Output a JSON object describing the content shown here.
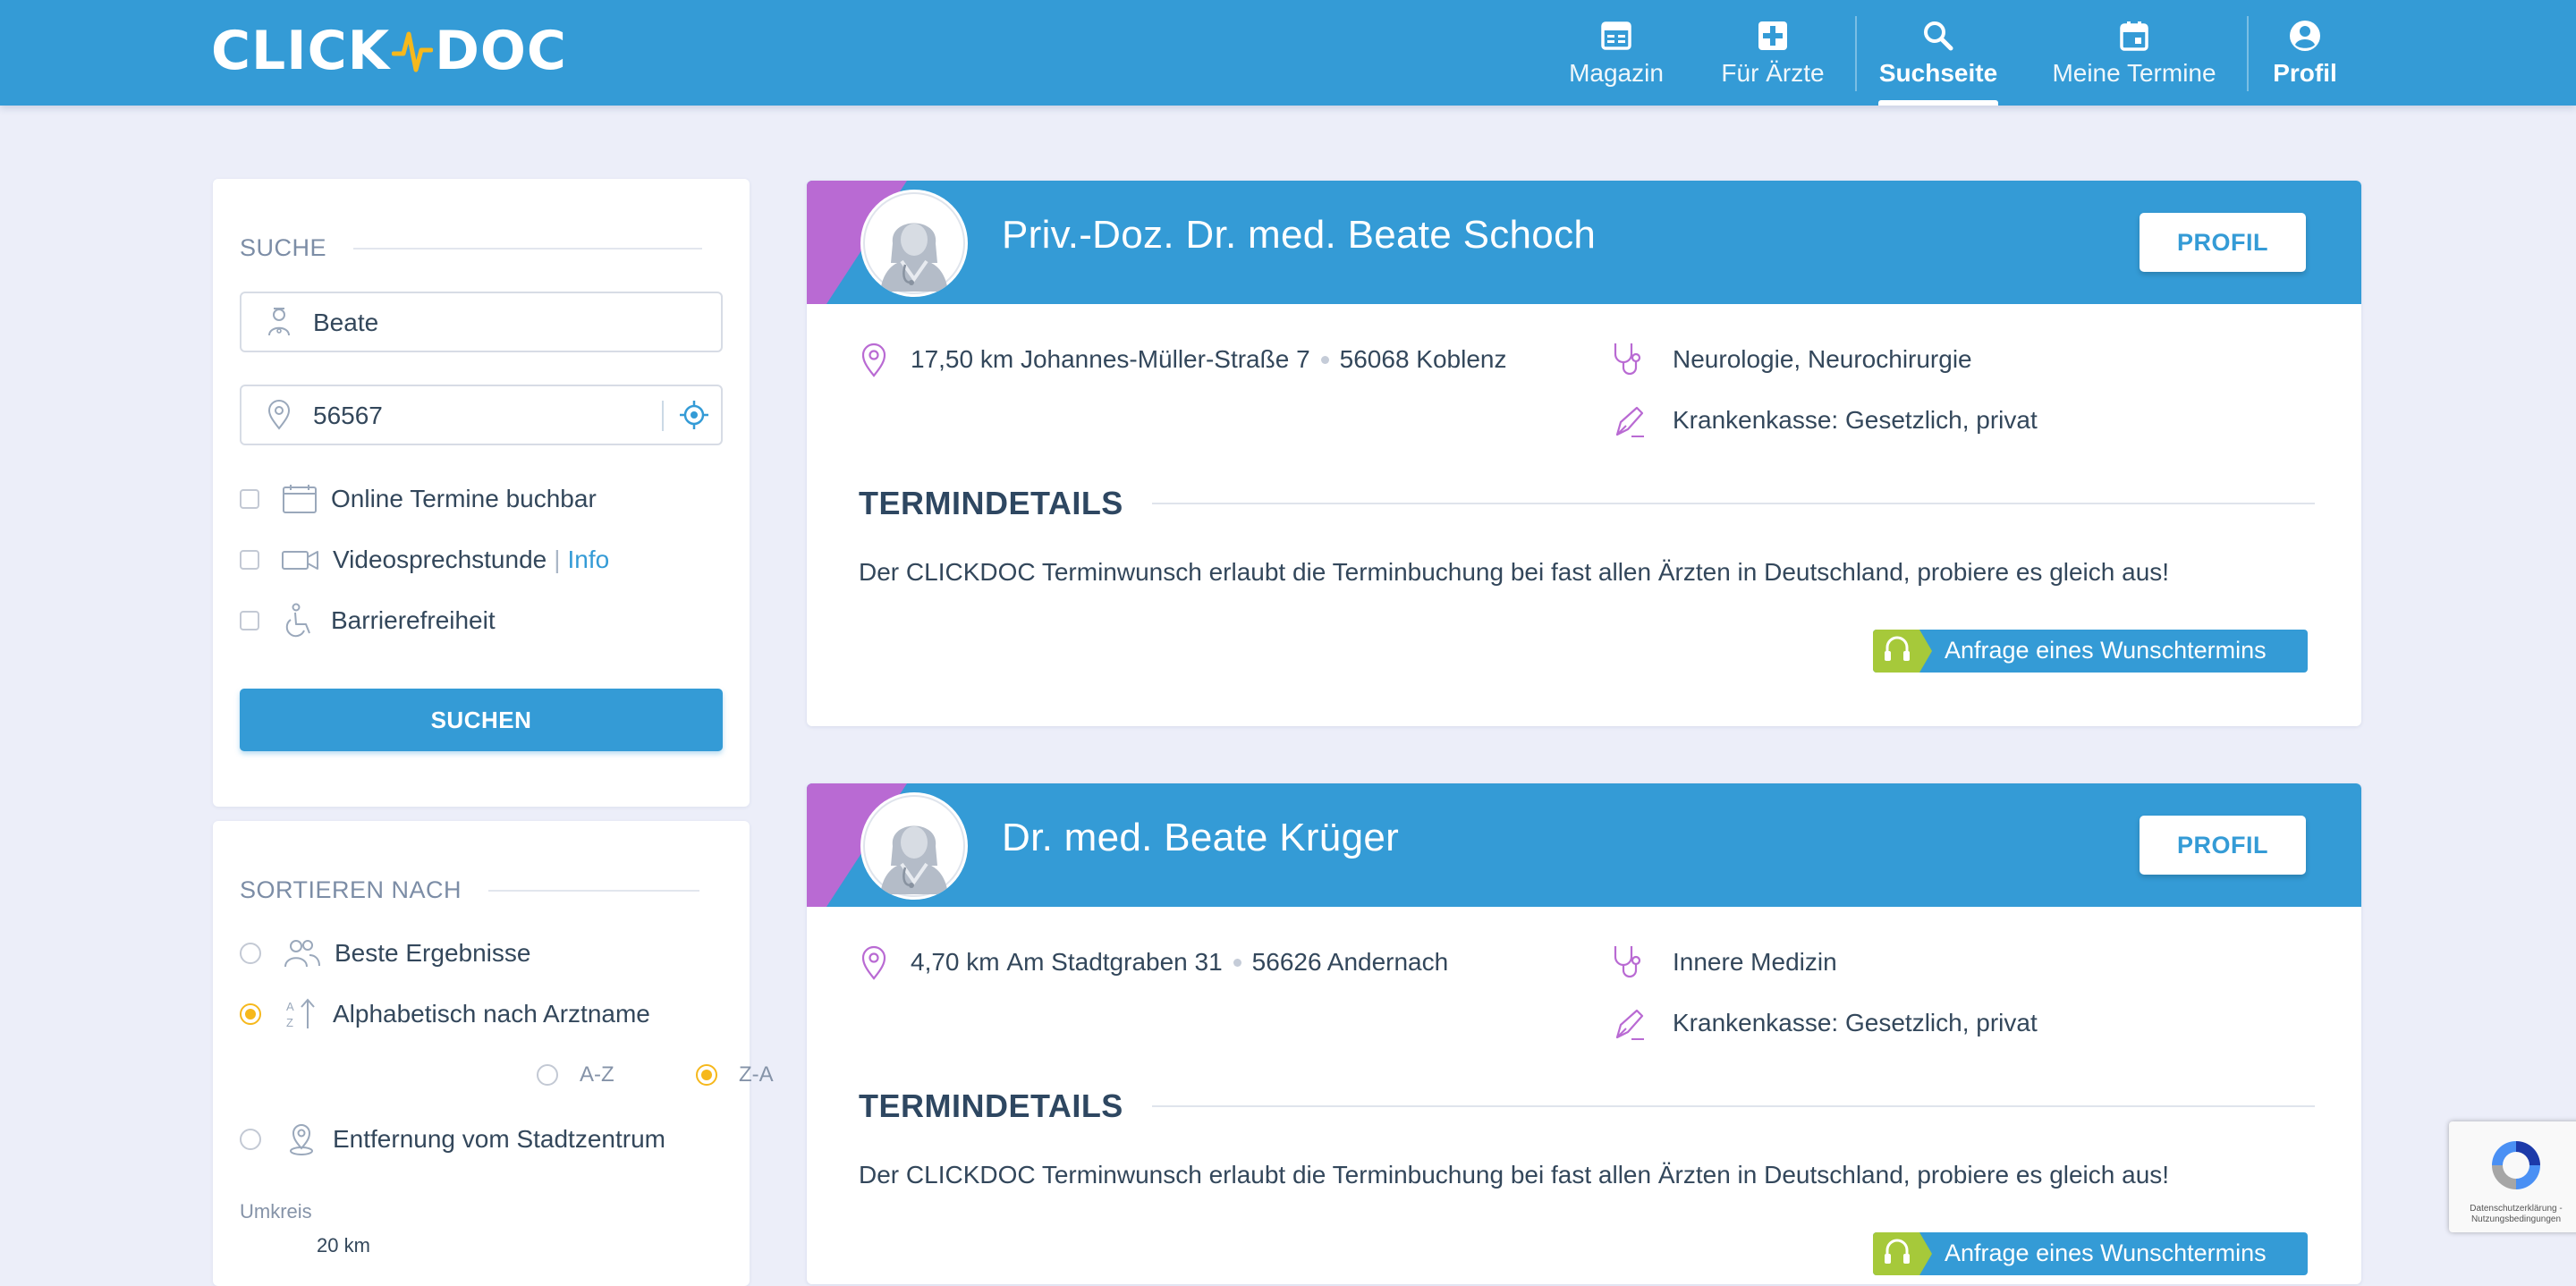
{
  "header": {
    "logo_left": "CLICK",
    "logo_right": "DOC",
    "nav": [
      {
        "label": "Magazin",
        "icon": "newspaper-icon"
      },
      {
        "label": "Für Ärzte",
        "icon": "medical-cross-icon"
      },
      {
        "label": "Suchseite",
        "icon": "search-icon",
        "active": true
      },
      {
        "label": "Meine Termine",
        "icon": "calendar-icon"
      },
      {
        "label": "Profil",
        "icon": "account-icon"
      }
    ]
  },
  "search": {
    "title": "SUCHE",
    "name_value": "Beate",
    "zip_value": "56567",
    "options": [
      {
        "label": "Online Termine buchbar",
        "checked": false,
        "icon": "calendar-icon"
      },
      {
        "label": "Videosprechstunde",
        "link": "Info",
        "separator": "|",
        "checked": false,
        "icon": "video-camera-icon"
      },
      {
        "label": "Barrierefreiheit",
        "checked": false,
        "icon": "wheelchair-icon"
      }
    ],
    "button_label": "SUCHEN"
  },
  "sort": {
    "title": "SORTIEREN NACH",
    "options": [
      {
        "label": "Beste Ergebnisse",
        "selected": false,
        "icon": "people-icon"
      },
      {
        "label": "Alphabetisch nach Arztname",
        "selected": true,
        "icon": "sort-alpha-icon"
      },
      {
        "label": "Entfernung vom Stadtzentrum",
        "selected": false,
        "icon": "location-pin-icon"
      }
    ],
    "alpha_options": [
      {
        "label": "A-Z",
        "selected": false
      },
      {
        "label": "Z-A",
        "selected": true
      }
    ],
    "radius_label": "Umkreis",
    "radius_value": "20 km"
  },
  "results": [
    {
      "name": "Priv.-Doz. Dr. med. Beate Schoch",
      "profile_button": "PROFIL",
      "distance": "17,50 km",
      "street": "Johannes-Müller-Straße 7",
      "city": "56068 Koblenz",
      "specialty": "Neurologie, Neurochirurgie",
      "insurance": "Krankenkasse: Gesetzlich, privat",
      "termin_title": "TERMINDETAILS",
      "termin_text": "Der CLICKDOC Terminwunsch erlaubt die Terminbuchung bei fast allen Ärzten in Deutschland, probiere es gleich aus!",
      "request_button": "Anfrage eines Wunschtermins"
    },
    {
      "name": "Dr. med. Beate Krüger",
      "profile_button": "PROFIL",
      "distance": "4,70 km",
      "street": "Am Stadtgraben 31",
      "city": "56626 Andernach",
      "specialty": "Innere Medizin",
      "insurance": "Krankenkasse: Gesetzlich, privat",
      "termin_title": "TERMINDETAILS",
      "termin_text": "Der CLICKDOC Terminwunsch erlaubt die Terminbuchung bei fast allen Ärzten in Deutschland, probiere es gleich aus!",
      "request_button": "Anfrage eines Wunschtermins"
    }
  ],
  "recaptcha": {
    "text_line1": "Datenschutzerklärung -",
    "text_line2": "Nutzungsbedingungen"
  },
  "colors": {
    "primary": "#349bd6",
    "accent_purple": "#b96ad3",
    "accent_lime": "#a6c93a",
    "accent_yellow": "#f6b81c",
    "background": "#eceef9"
  }
}
